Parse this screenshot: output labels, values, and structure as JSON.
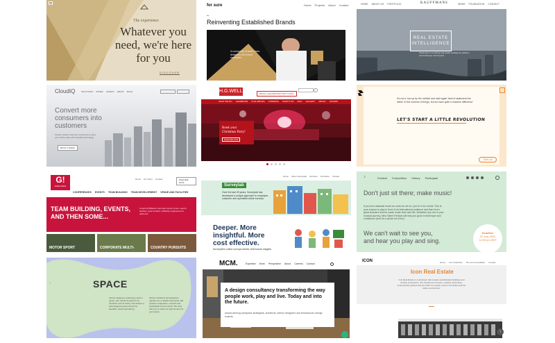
{
  "tile_wey": {
    "tag": "The experience",
    "headline_l1": "Whatever you",
    "headline_l2": "need, we're here",
    "headline_l3": "for you",
    "footer": "DISCOVER"
  },
  "tile_forsure": {
    "brand": "for sure",
    "nav": [
      "Home",
      "Projects",
      "About",
      "Contact"
    ],
    "headline": "Reinventing Established Brands",
    "caption": "A community of world class designers and brand strategists"
  },
  "tile_kauffmans": {
    "nav_left": [
      "HOME",
      "ABOUT US",
      "PORTFOLIO"
    ],
    "brand": "KAUFFMANS",
    "nav_right": [
      "NEWS",
      "FOUNDATION",
      "CONTACT"
    ],
    "hero_l1": "REAL ESTATE",
    "hero_l2": "INTELLIGENCE",
    "body": "Kauffmans is a leading real estate intelligence platform across Europe and beyond."
  },
  "tile_cloudiq": {
    "logo": "CloudIQ",
    "nav": [
      "SOLUTIONS",
      "ZONES",
      "ASSETS",
      "ABOUT",
      "BLOG"
    ],
    "headline_l1": "Convert more",
    "headline_l2": "consumers into",
    "headline_l3": "customers",
    "body": "Create a better customer experience to grow your online sales with CloudIQ technology.",
    "cta": "BOOK A DEMO"
  },
  "tile_hgwells": {
    "logo": "H.G.WELLS",
    "nav": [
      "WHAT WE DO",
      "CELEBRATE",
      "OUR SPACES",
      "CATERING",
      "WHAT'S ON",
      "INFO",
      "GALLERY",
      "ABOUT",
      "OFFERS"
    ],
    "cta": "BOOK A SHOWROOM VISIT TODAY",
    "promo_l1": "Book your",
    "promo_l2": "Christmas Party!",
    "promo_btn": "ENQUIRE NOW"
  },
  "tile_revolution": {
    "body": "It's not a 'row up by the rubbish and start again' kind of statement but rather 'in the scheme of things, but we have quite a massive difference'",
    "headline": "LET'S START A LITTLE REVOLUTION",
    "btn": "JOIN US"
  },
  "tile_garlands": {
    "logo": "G!",
    "logo_sub": "GARLANDS",
    "nav_top": [
      "Home",
      "Our Story",
      "Contact"
    ],
    "cta": "ENQUIRE NOW",
    "nav": [
      "CONFERENCES",
      "EVENTS",
      "TEAM BUILDING",
      "TEAM DEVELOPMENT",
      "VENUE AND FACILITIES"
    ],
    "headline_l1": "TEAM BUILDING, EVENTS,",
    "headline_l2": "AND THEN SOME...",
    "body": "Amazing Midlands corporate events venue, superb facilities, great location, brilliantly organised and delivered.",
    "cards": [
      "MOTOR SPORT",
      "CORPORATE MULTI-",
      "COUNTRY PURSUITS"
    ]
  },
  "tile_surveylab": {
    "nav": [
      "Home",
      "About Surveylab",
      "Services",
      "Job Alerts",
      "Contact"
    ],
    "logo": "Surveylab",
    "body": "Over the last 20 years, Surveylab has developed a unique approach to employee, customer and specialist online surveys.",
    "headline_l1": "Deeper. More",
    "headline_l2": "insightful. More",
    "headline_l3": "cost effective.",
    "tagline": "Surveylab's online surveys deliver real human insights."
  },
  "tile_music": {
    "logo": "♪",
    "nav": [
      "Festival",
      "Competition",
      "History",
      "Participate"
    ],
    "headline": "Don't just sit there; make music!",
    "body": "If you love classical music as much as we do, you're in for a treat. This is your chance to play in front of an international audience and learn from great teachers who've made music their own life. Whatever you are in your musical journey, New Talent Festival will help you grow in technique and confidence (and for a whole lot of fun).",
    "quote_l1": "We can't wait to see you,",
    "quote_l2": "and hear you play and sing.",
    "badge_l1": "Deadline",
    "badge_l2": "22 July 2022",
    "badge_l3": "11:59 pm BST"
  },
  "tile_space": {
    "headline": "SPACE",
    "col1": "Interior designers collectively work in space, with careful thought for its character and its history. We believe a well-designed space should be beautiful, useful and lasting.",
    "col2": "Interior architects and designers together for a reliable framework. We produce imaginative, relevant and sustainable environments. We work with you to make the right choices for your space."
  },
  "tile_mcm": {
    "logo": "MCM.",
    "nav": [
      "Expertise",
      "Work",
      "Perspective",
      "About",
      "Careers",
      "Contact"
    ],
    "headline": "A design consultancy transforming the way people work, play and live. Today and into the future.",
    "body": "Award-winning workplace strategists, architects, interior designers and behavioural change experts."
  },
  "tile_icon": {
    "logo": "ICON",
    "nav": [
      "Home",
      "Icon Collection",
      "The Icon Foundation",
      "Contact"
    ],
    "headline": "Icon Real Estate",
    "body": "Icon Real Estate is a developer that creates sophisticated buildings and thriving ecosystems. We simplify the complex, creating world-class, contemporary spaces that are better for people, local communities and the wider environment."
  },
  "colors": {
    "wey_bg": "#e6dcc6",
    "garlands_red": "#c8143c",
    "hgwells_red": "#b5121b",
    "surveylab_green": "#3b8c3a",
    "music_green": "#cfe8d3",
    "space_green": "#cfe3c9",
    "icon_orange": "#e9832c"
  }
}
